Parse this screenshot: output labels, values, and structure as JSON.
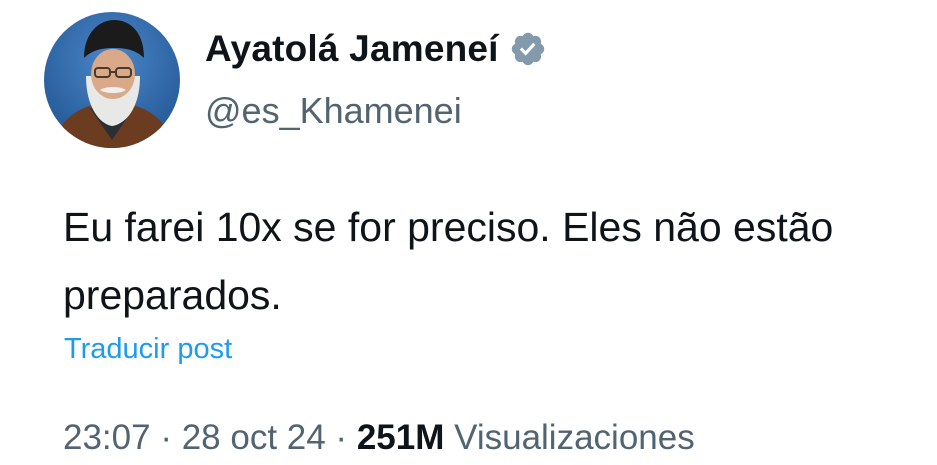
{
  "tweet": {
    "display_name": "Ayatolá Jameneí",
    "handle": "@es_Khamenei",
    "verified_icon": "verified-badge-icon",
    "text": "Eu farei 10x se for preciso. Eles não estão preparados.",
    "translate_label": "Traducir post",
    "time": "23:07",
    "separator": " · ",
    "date": "28 oct 24",
    "views_count": "251M",
    "views_label": "Visualizaciones"
  },
  "colors": {
    "link": "#1d9bf0",
    "secondary_text": "#536471",
    "primary_text": "#0f1419",
    "verified_badge": "#829aab"
  }
}
